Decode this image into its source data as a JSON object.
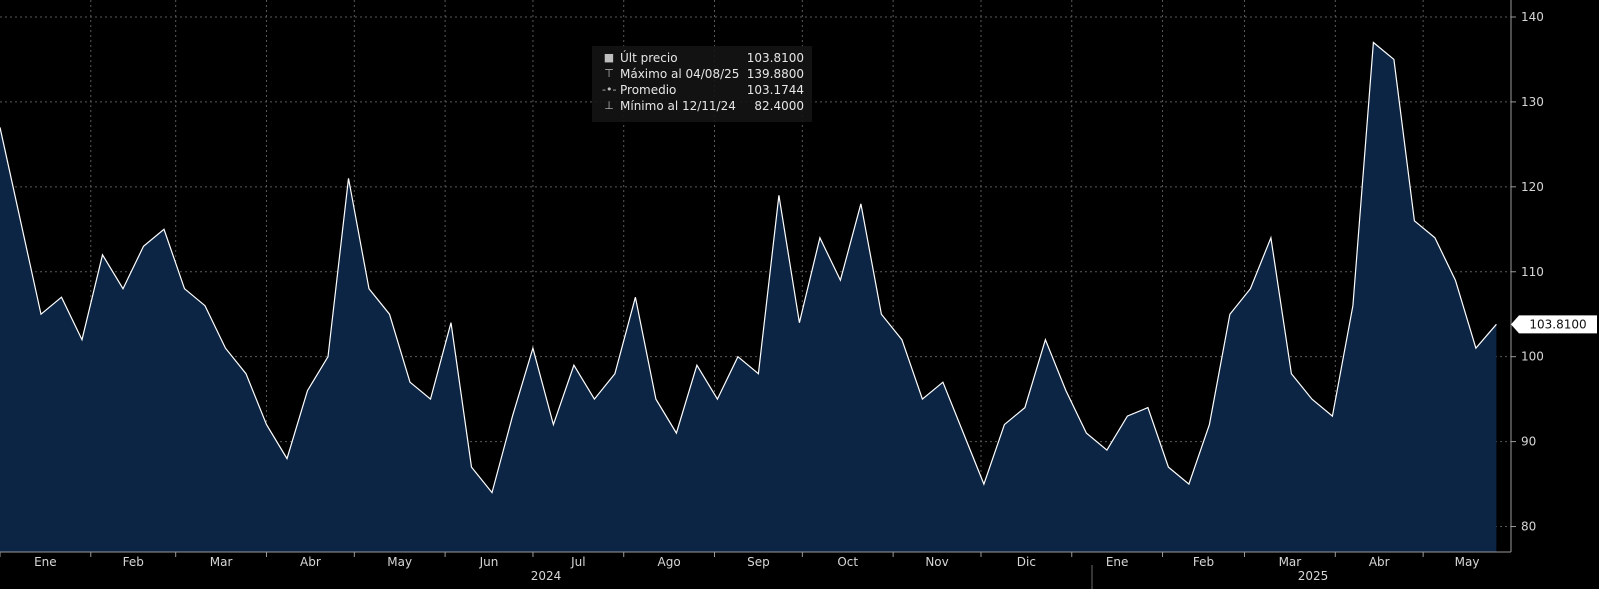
{
  "legend": {
    "last_label": "Últ precio",
    "last_value": "103.8100",
    "max_label": "Máximo al 04/08/25",
    "max_value": "139.8800",
    "avg_label": "Promedio",
    "avg_value": "103.1744",
    "min_label": "Mínimo al 12/11/24",
    "min_value": "82.4000"
  },
  "last_badge": "103.8100",
  "colors": {
    "background": "#000000",
    "line": "#ffffff",
    "fill": "#0c2544",
    "grid": "#5a5a5a",
    "badge": "#ffffff"
  },
  "chart_data": {
    "type": "area",
    "x_start": "2024-01-01",
    "x_end": "2025-05-31",
    "ylim": [
      77,
      142
    ],
    "yticks": [
      80,
      90,
      100,
      110,
      120,
      130,
      140
    ],
    "ytick_labels": [
      "80",
      "90",
      "100",
      "110",
      "120",
      "130",
      "140"
    ],
    "xtick_labels": [
      "Ene",
      "Feb",
      "Mar",
      "Abr",
      "May",
      "Jun",
      "Jul",
      "Ago",
      "Sep",
      "Oct",
      "Nov",
      "Dic",
      "Ene",
      "Feb",
      "Mar",
      "Abr",
      "May"
    ],
    "year_labels": [
      "2024",
      "2025"
    ],
    "grid": true,
    "series": [
      {
        "x": [
          "2024-01-01",
          "2024-01-08",
          "2024-01-15",
          "2024-01-22",
          "2024-01-29",
          "2024-02-05",
          "2024-02-12",
          "2024-02-19",
          "2024-02-26",
          "2024-03-04",
          "2024-03-11",
          "2024-03-18",
          "2024-03-25",
          "2024-04-01",
          "2024-04-08",
          "2024-04-15",
          "2024-04-22",
          "2024-04-29",
          "2024-05-06",
          "2024-05-13",
          "2024-05-20",
          "2024-05-27",
          "2024-06-03",
          "2024-06-10",
          "2024-06-17",
          "2024-06-24",
          "2024-07-01",
          "2024-07-08",
          "2024-07-15",
          "2024-07-22",
          "2024-07-29",
          "2024-08-05",
          "2024-08-12",
          "2024-08-19",
          "2024-08-26",
          "2024-09-02",
          "2024-09-09",
          "2024-09-16",
          "2024-09-23",
          "2024-09-30",
          "2024-10-07",
          "2024-10-14",
          "2024-10-21",
          "2024-10-28",
          "2024-11-04",
          "2024-11-11",
          "2024-11-18",
          "2024-11-25",
          "2024-12-02",
          "2024-12-09",
          "2024-12-16",
          "2024-12-23",
          "2024-12-30",
          "2025-01-06",
          "2025-01-13",
          "2025-01-20",
          "2025-01-27",
          "2025-02-03",
          "2025-02-10",
          "2025-02-17",
          "2025-02-24",
          "2025-03-03",
          "2025-03-10",
          "2025-03-17",
          "2025-03-24",
          "2025-03-31",
          "2025-04-07",
          "2025-04-14",
          "2025-04-21",
          "2025-04-28",
          "2025-05-05",
          "2025-05-12",
          "2025-05-19",
          "2025-05-26"
        ],
        "values": [
          127,
          116,
          105,
          107,
          102,
          112,
          108,
          113,
          115,
          108,
          106,
          101,
          98,
          92,
          88,
          96,
          100,
          121,
          108,
          105,
          97,
          95,
          104,
          87,
          84,
          93,
          101,
          92,
          99,
          95,
          98,
          107,
          95,
          91,
          99,
          95,
          100,
          98,
          119,
          104,
          114,
          109,
          118,
          105,
          102,
          95,
          97,
          91,
          85,
          92,
          94,
          102,
          96,
          91,
          89,
          93,
          94,
          87,
          85,
          92,
          105,
          108,
          114,
          98,
          95,
          93,
          106,
          137,
          135,
          116,
          114,
          109,
          101,
          103.81
        ]
      }
    ]
  }
}
